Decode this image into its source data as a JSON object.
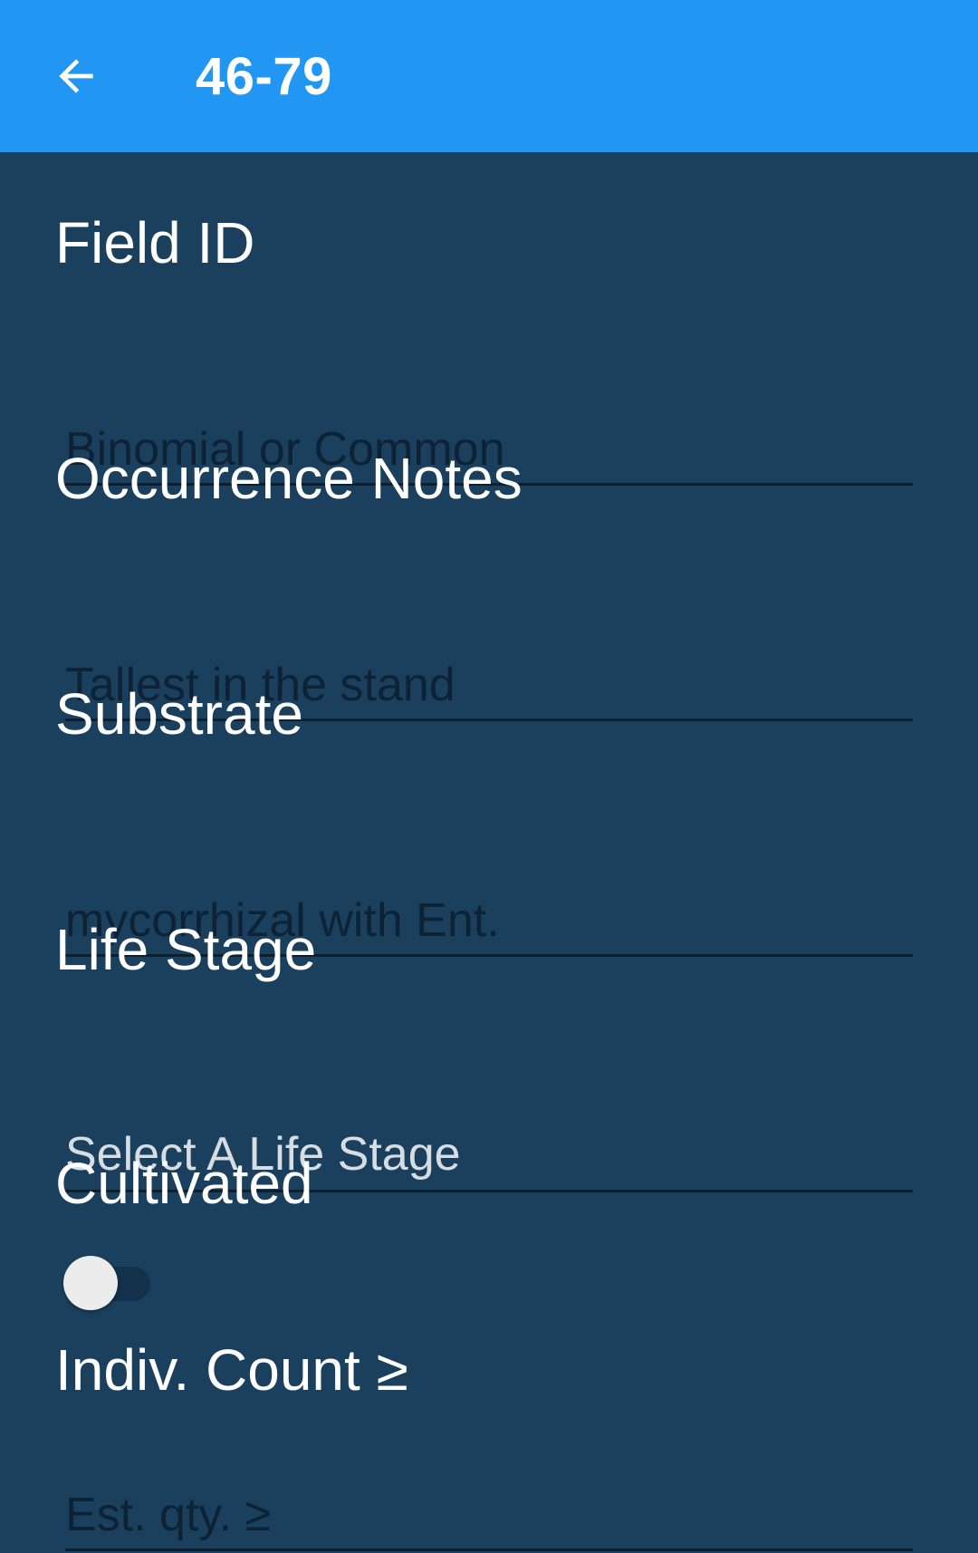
{
  "app_bar": {
    "title": "46-79",
    "back_icon": "arrow-left-icon",
    "background_color": "#2196f3"
  },
  "form": {
    "field_id": {
      "label": "Field ID",
      "placeholder": "Binomial or Common",
      "value": ""
    },
    "occurrence_notes": {
      "label": "Occurrence Notes",
      "placeholder": "Tallest in the stand",
      "value": ""
    },
    "substrate": {
      "label": "Substrate",
      "placeholder": "mycorrhizal with Ent.",
      "value": ""
    },
    "life_stage": {
      "label": "Life Stage",
      "selected_text": "Select A Life Stage"
    },
    "cultivated": {
      "label": "Cultivated",
      "checked": false
    },
    "indiv_count": {
      "label": "Indiv. Count ≥",
      "placeholder": "Est. qty. ≥",
      "value": ""
    }
  },
  "colors": {
    "background": "#1b405e",
    "underline": "#0d1f2f",
    "label_text": "#ffffff"
  }
}
